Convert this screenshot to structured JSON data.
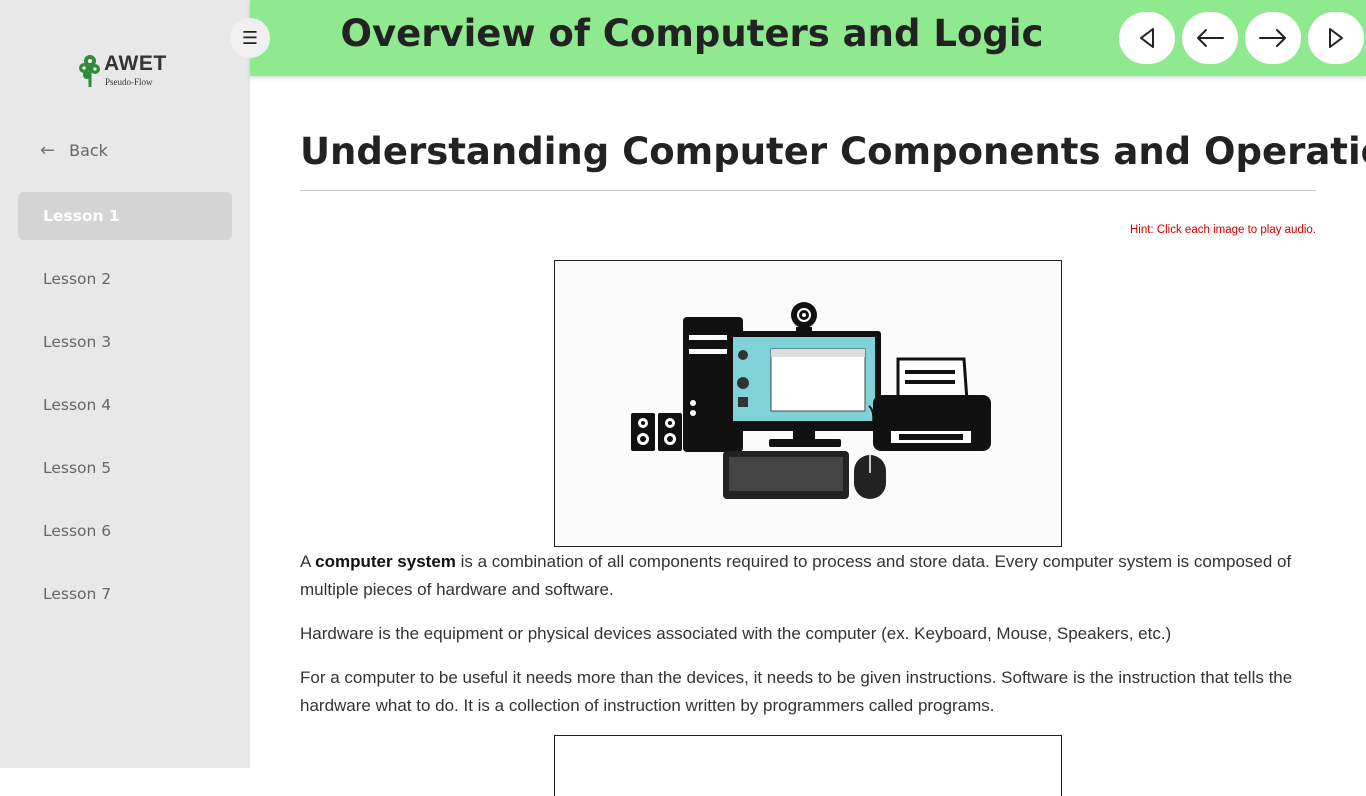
{
  "sidebar": {
    "logo_text": "AWET",
    "logo_sub": "Pseudo-Flow",
    "back_label": "Back",
    "items": [
      {
        "label": "Lesson 1",
        "active": true
      },
      {
        "label": "Lesson 2"
      },
      {
        "label": "Lesson 3"
      },
      {
        "label": "Lesson 4"
      },
      {
        "label": "Lesson 5"
      },
      {
        "label": "Lesson 6"
      },
      {
        "label": "Lesson 7"
      }
    ]
  },
  "header": {
    "title": "Overview of Computers and Logic",
    "header_color": "#8fea8f",
    "nav_icons": [
      "triangle-left-icon",
      "arrow-left-icon",
      "arrow-right-icon",
      "triangle-right-icon"
    ]
  },
  "content": {
    "title": "Understanding Computer Components and Operations",
    "hint": "Hint: Click each image to play audio.",
    "para1_prefix": "A ",
    "para1_bold": "computer system",
    "para1_rest": " is a combination of all components required to process and store data. Every computer system is composed of multiple pieces of hardware and software.",
    "para2": "Hardware is the equipment or physical devices associated with the computer (ex. Keyboard, Mouse, Speakers, etc.)",
    "para3": "For a computer to be useful it needs more than the devices, it needs to be given instructions. Software is the instruction that tells the hardware what to do. It is a collection of instruction written by programmers called programs."
  }
}
